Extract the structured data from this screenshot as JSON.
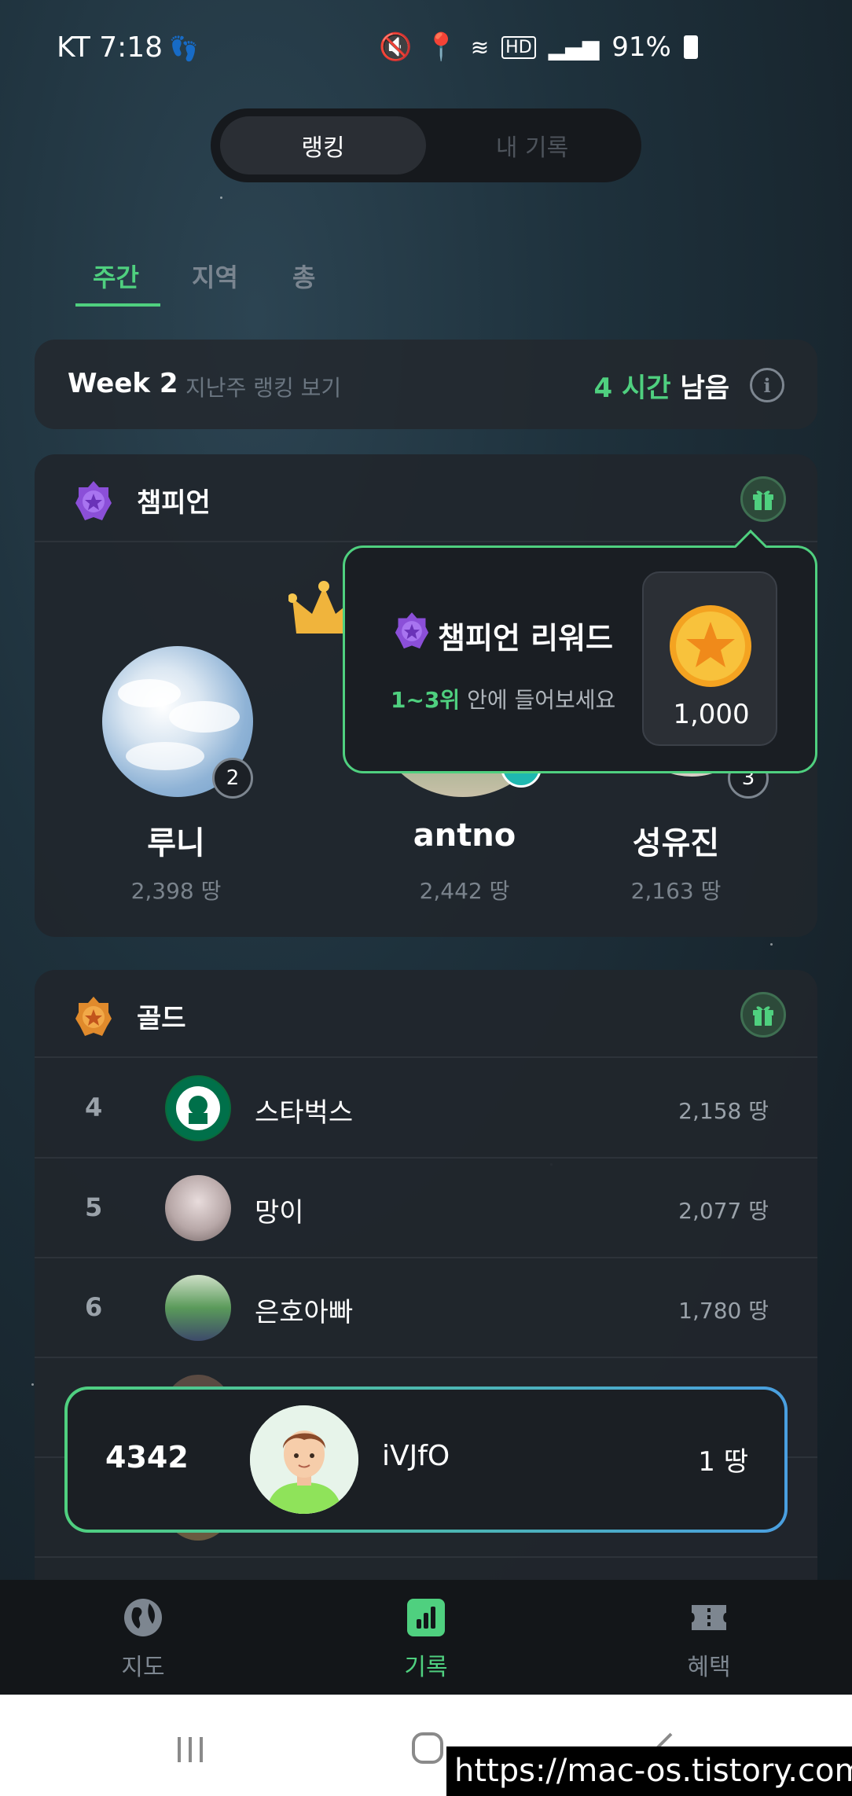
{
  "status_bar": {
    "carrier_time": "KT 7:18",
    "battery": "91%"
  },
  "segment": {
    "ranking": "랭킹",
    "my_record": "내 기록"
  },
  "tabs": {
    "weekly": "주간",
    "region": "지역",
    "total": "총"
  },
  "week_card": {
    "title": "Week 2",
    "last_week_link": "지난주 랭킹 보기",
    "hours_left": "4 시간",
    "left_suffix": "남음",
    "info": "i"
  },
  "champion": {
    "title": "챔피언",
    "podium": [
      {
        "rank": "2",
        "name": "루니",
        "score": "2,398 땅"
      },
      {
        "rank": "1",
        "name": "antno",
        "score": "2,442 땅"
      },
      {
        "rank": "3",
        "name": "성유진",
        "score": "2,163 땅"
      }
    ],
    "tooltip": {
      "title": "챔피언 리워드",
      "sub_highlight": "1~3위",
      "sub_rest": " 안에 들어보세요",
      "reward": "1,000"
    }
  },
  "gold": {
    "title": "골드",
    "rows": [
      {
        "rank": "4",
        "name": "스타벅스",
        "score": "2,158 땅"
      },
      {
        "rank": "5",
        "name": "망이",
        "score": "2,077 땅"
      },
      {
        "rank": "6",
        "name": "은호아빠",
        "score": "1,780 땅"
      }
    ]
  },
  "my_rank": {
    "rank": "4342",
    "name": "iVJfO",
    "score": "1 땅"
  },
  "bottom_nav": {
    "map": "지도",
    "record": "기록",
    "benefits": "혜택"
  },
  "watermark": "https://mac-os.tistory.com",
  "colors": {
    "accent": "#4fd07f",
    "background": "#1e313c",
    "card": "#23282e"
  }
}
